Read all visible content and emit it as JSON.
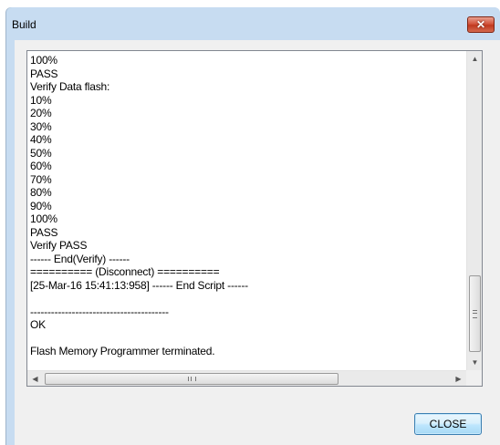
{
  "window": {
    "title": "Build",
    "close_glyph": "✕"
  },
  "log": {
    "lines": [
      "100%",
      "PASS",
      "Verify Data flash:",
      "10%",
      "20%",
      "30%",
      "40%",
      "50%",
      "60%",
      "70%",
      "80%",
      "90%",
      "100%",
      "PASS",
      "Verify PASS",
      "------ End(Verify) ------",
      "========== (Disconnect) ==========",
      "[25-Mar-16 15:41:13:958] ------ End Script ------",
      "",
      "----------------------------------------",
      "OK",
      "",
      "Flash Memory Programmer terminated.",
      ""
    ]
  },
  "scrollbar": {
    "up_arrow": "▲",
    "down_arrow": "▼",
    "left_arrow": "◀",
    "right_arrow": "▶"
  },
  "buttons": {
    "close_label": "CLOSE"
  }
}
